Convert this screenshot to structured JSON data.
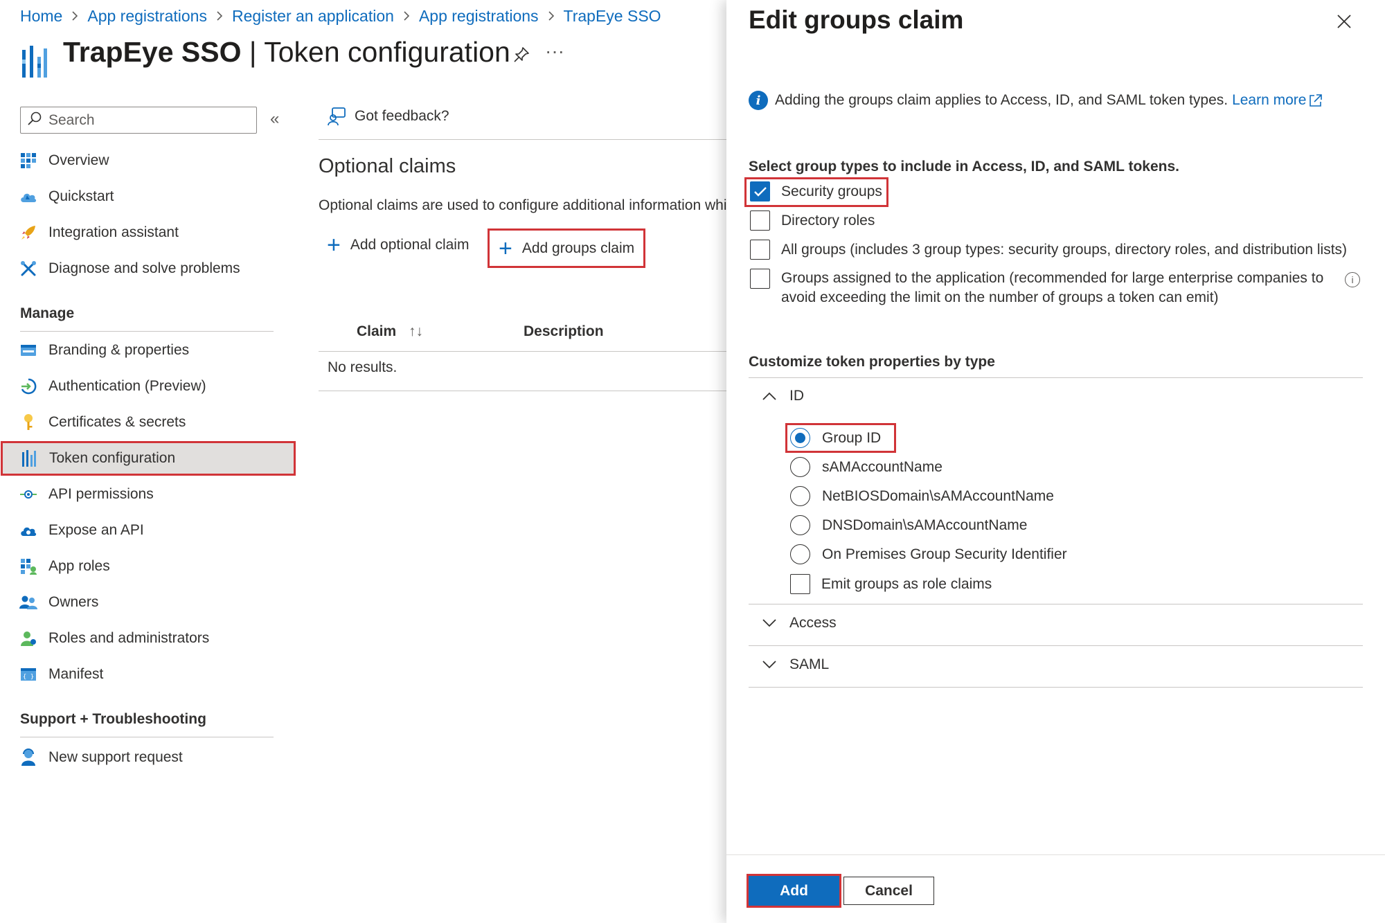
{
  "breadcrumb": [
    "Home",
    "App registrations",
    "Register an application",
    "App registrations",
    "TrapEye SSO"
  ],
  "title": {
    "app": "TrapEye SSO",
    "separator": " | ",
    "page": "Token configuration"
  },
  "header_icons": {
    "pin": "pin-icon",
    "more": "···"
  },
  "search": {
    "placeholder": "Search",
    "collapse": "«"
  },
  "sidebar": {
    "top_items": [
      "Overview",
      "Quickstart",
      "Integration assistant",
      "Diagnose and solve problems"
    ],
    "manage_title": "Manage",
    "manage_items": [
      "Branding & properties",
      "Authentication (Preview)",
      "Certificates & secrets",
      "Token configuration",
      "API permissions",
      "Expose an API",
      "App roles",
      "Owners",
      "Roles and administrators",
      "Manifest"
    ],
    "selected": "Token configuration",
    "support_title": "Support + Troubleshooting",
    "support_items": [
      "New support request"
    ]
  },
  "main": {
    "feedback": "Got feedback?",
    "section_title": "Optional claims",
    "description": "Optional claims are used to configure additional information which is returned in one or more tokens.",
    "add_optional_claim": "Add optional claim",
    "add_groups_claim": "Add groups claim",
    "table": {
      "columns": [
        "Claim",
        "Description"
      ],
      "sort_icon": "↑↓",
      "empty": "No results."
    }
  },
  "panel": {
    "title": "Edit groups claim",
    "info_text": "Adding the groups claim applies to Access, ID, and SAML token types.",
    "learn_more": "Learn more",
    "group_types_label": "Select group types to include in Access, ID, and SAML tokens.",
    "group_types": [
      {
        "label": "Security groups",
        "checked": true
      },
      {
        "label": "Directory roles",
        "checked": false
      },
      {
        "label": "All groups (includes 3 group types: security groups, directory roles, and distribution lists)",
        "checked": false
      },
      {
        "label": "Groups assigned to the application (recommended for large enterprise companies to avoid exceeding the limit on the number of groups a token can emit)",
        "checked": false
      }
    ],
    "customize_label": "Customize token properties by type",
    "sections": [
      {
        "label": "ID",
        "expanded": true
      },
      {
        "label": "Access",
        "expanded": false
      },
      {
        "label": "SAML",
        "expanded": false
      }
    ],
    "id_options": [
      {
        "label": "Group ID",
        "selected": true
      },
      {
        "label": "sAMAccountName",
        "selected": false
      },
      {
        "label": "NetBIOSDomain\\sAMAccountName",
        "selected": false
      },
      {
        "label": "DNSDomain\\sAMAccountName",
        "selected": false
      },
      {
        "label": "On Premises Group Security Identifier",
        "selected": false
      }
    ],
    "emit_role_claims": {
      "label": "Emit groups as role claims",
      "checked": false
    },
    "buttons": {
      "add": "Add",
      "cancel": "Cancel"
    }
  },
  "colors": {
    "accent": "#0f6cbd",
    "highlight": "#d13438",
    "selected_bg": "#e1dfdd"
  }
}
